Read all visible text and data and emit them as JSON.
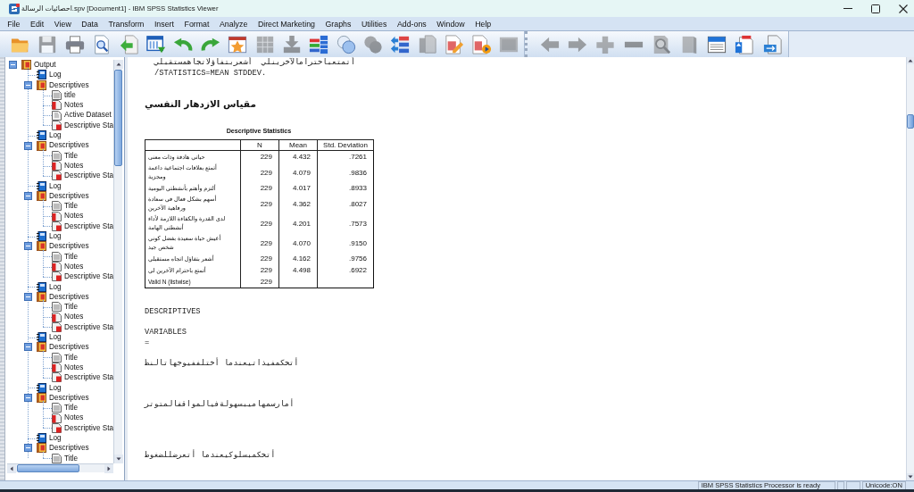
{
  "window": {
    "title": "احصائيات الرسالة.spv [Document1] - IBM SPSS Statistics Viewer"
  },
  "menu": [
    {
      "label": "File"
    },
    {
      "label": "Edit"
    },
    {
      "label": "View"
    },
    {
      "label": "Data"
    },
    {
      "label": "Transform"
    },
    {
      "label": "Insert"
    },
    {
      "label": "Format"
    },
    {
      "label": "Analyze"
    },
    {
      "label": "Direct Marketing"
    },
    {
      "label": "Graphs"
    },
    {
      "label": "Utilities"
    },
    {
      "label": "Add-ons"
    },
    {
      "label": "Window"
    },
    {
      "label": "Help"
    }
  ],
  "toolbar": [
    {
      "buttons": [
        {
          "disabled": false
        },
        {
          "disabled": true
        },
        {
          "disabled": false
        },
        {
          "disabled": false
        },
        {
          "disabled": false
        },
        {
          "disabled": false
        },
        {
          "disabled": false
        },
        {
          "disabled": false
        },
        {
          "disabled": false
        },
        {
          "disabled": true
        },
        {
          "disabled": true
        },
        {
          "disabled": false
        },
        {
          "disabled": false
        },
        {
          "disabled": true
        },
        {
          "disabled": false
        },
        {
          "disabled": true
        },
        {
          "disabled": false
        },
        {
          "disabled": false
        },
        {
          "disabled": true
        }
      ]
    },
    {
      "buttons": [
        {
          "disabled": true
        },
        {
          "disabled": true
        },
        {
          "disabled": true
        },
        {
          "disabled": true
        },
        {
          "disabled": true
        },
        {
          "disabled": true
        },
        {
          "disabled": false
        },
        {
          "disabled": false
        },
        {
          "disabled": false
        }
      ]
    }
  ],
  "outline": {
    "label": "Output",
    "kind": "output",
    "expanded": true,
    "children": [
      {
        "label": "Log",
        "kind": "log"
      },
      {
        "label": "Descriptives",
        "kind": "procedure",
        "expanded": true,
        "children": [
          {
            "label": "title",
            "kind": "title"
          },
          {
            "label": "Notes",
            "kind": "notes"
          },
          {
            "label": "Active Dataset",
            "kind": "dataset"
          },
          {
            "label": "Descriptive Sta",
            "kind": "table"
          }
        ]
      },
      {
        "label": "Log",
        "kind": "log"
      },
      {
        "label": "Descriptives",
        "kind": "procedure",
        "expanded": true,
        "children": [
          {
            "label": "Title",
            "kind": "title"
          },
          {
            "label": "Notes",
            "kind": "notes"
          },
          {
            "label": "Descriptive Sta",
            "kind": "table"
          }
        ]
      },
      {
        "label": "Log",
        "kind": "log"
      },
      {
        "label": "Descriptives",
        "kind": "procedure",
        "expanded": true,
        "children": [
          {
            "label": "Title",
            "kind": "title"
          },
          {
            "label": "Notes",
            "kind": "notes"
          },
          {
            "label": "Descriptive Sta",
            "kind": "table"
          }
        ]
      },
      {
        "label": "Log",
        "kind": "log"
      },
      {
        "label": "Descriptives",
        "kind": "procedure",
        "expanded": true,
        "children": [
          {
            "label": "Title",
            "kind": "title"
          },
          {
            "label": "Notes",
            "kind": "notes"
          },
          {
            "label": "Descriptive Sta",
            "kind": "table"
          }
        ]
      },
      {
        "label": "Log",
        "kind": "log"
      },
      {
        "label": "Descriptives",
        "kind": "procedure",
        "expanded": true,
        "children": [
          {
            "label": "Title",
            "kind": "title"
          },
          {
            "label": "Notes",
            "kind": "notes"
          },
          {
            "label": "Descriptive Sta",
            "kind": "table"
          }
        ]
      },
      {
        "label": "Log",
        "kind": "log"
      },
      {
        "label": "Descriptives",
        "kind": "procedure",
        "expanded": true,
        "children": [
          {
            "label": "Title",
            "kind": "title"
          },
          {
            "label": "Notes",
            "kind": "notes"
          },
          {
            "label": "Descriptive Sta",
            "kind": "table"
          }
        ]
      },
      {
        "label": "Log",
        "kind": "log"
      },
      {
        "label": "Descriptives",
        "kind": "procedure",
        "expanded": true,
        "children": [
          {
            "label": "Title",
            "kind": "title"
          },
          {
            "label": "Notes",
            "kind": "notes"
          },
          {
            "label": "Descriptive Sta",
            "kind": "table"
          }
        ]
      },
      {
        "label": "Log",
        "kind": "log"
      },
      {
        "label": "Descriptives",
        "kind": "procedure",
        "expanded": true,
        "children": [
          {
            "label": "Title",
            "kind": "title"
          }
        ]
      }
    ]
  },
  "output": {
    "log_top": "أتمتعباحترامالآخرينلي  أشعربتفاؤلاتجاهمستقبلي\n/STATISTICS=MEAN STDDEV.",
    "heading": "مقياس الازدهار النفسي",
    "table": {
      "title": "Descriptive Statistics",
      "columns": [
        "N",
        "Mean",
        "Std. Deviation"
      ],
      "rows": [
        {
          "label": "حياتي هادفة وذات معنى",
          "values": [
            "229",
            "4.432",
            ".7261"
          ]
        },
        {
          "label": "أتمتع بعلاقات اجتماعية داعمة ومجزية",
          "values": [
            "229",
            "4.079",
            ".9836"
          ]
        },
        {
          "label": "ألتزم وأهتم بأنشطتي اليومية",
          "values": [
            "229",
            "4.017",
            ".8933"
          ]
        },
        {
          "label": "أسهم بشكل فعال في سعادة ورفاهية الآخرين",
          "values": [
            "229",
            "4.362",
            ".8027"
          ]
        },
        {
          "label": "لدي القدرة والكفاءة اللازمة لأداء أنشطتي الهامة",
          "values": [
            "229",
            "4.201",
            ".7573"
          ]
        },
        {
          "label": "أعيش حياة سعيدة بفضل كوني شخص جيد",
          "values": [
            "229",
            "4.070",
            ".9150"
          ]
        },
        {
          "label": "أشعر بتفاؤل اتجاه مستقبلي",
          "values": [
            "229",
            "4.162",
            ".9756"
          ]
        },
        {
          "label": "أتمتع باحترام الآخرين لي",
          "values": [
            "229",
            "4.498",
            ".6922"
          ]
        },
        {
          "label": "Valid N (listwise)",
          "values": [
            "229"
          ]
        }
      ]
    },
    "log_bottom": "DESCRIPTIVES\n\nVARIABLES\n=\n\nأتحكمفيذاتيعندما أختلففيوجهاتالنظ\n\n\n\nأمارسمهاميبسهولةفيالمواقفالمتوتر\n\n\n\n\nأتحكمبسلوكيعندما أتعرضللضغوط"
  },
  "status_bar": {
    "message": "IBM SPSS Statistics Processor is ready",
    "encoding": "Unicode:ON"
  }
}
